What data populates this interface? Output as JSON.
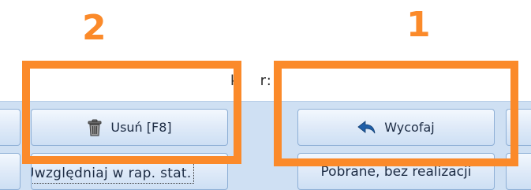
{
  "annotations": {
    "number_2": "2",
    "number_1": "1",
    "highlight_color": "#fb8a2a"
  },
  "background_label": {
    "left_fragment": "k",
    "right_fragment": "r:"
  },
  "toolbar": {
    "background": "#cfe0f3",
    "delete_button_label": "Usuń [F8]",
    "delete_button_icon": "trash-icon",
    "undo_button_label": "Wycofaj",
    "undo_button_icon": "undo-arrow-icon",
    "include_in_stats_label": "Uwzględniaj w rap. stat.",
    "fetched_no_realization_label": "Pobrane, bez realizacji"
  }
}
